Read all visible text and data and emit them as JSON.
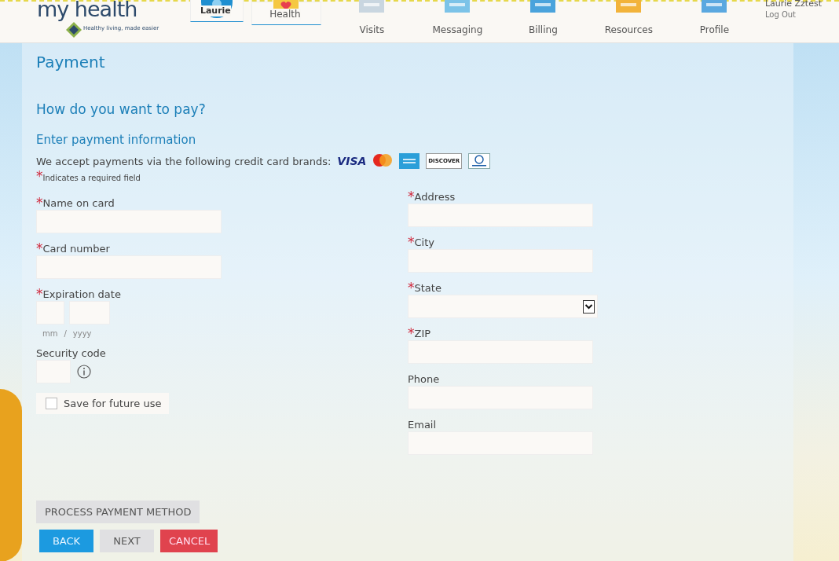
{
  "brand": {
    "name": "my health",
    "tagline": "Healthy living, made easier"
  },
  "nav": [
    {
      "label": "Laurie",
      "kind": "avatar",
      "selected": true
    },
    {
      "label": "Health",
      "kind": "heart",
      "selected": true
    },
    {
      "label": "Visits",
      "kind": "calendar",
      "selected": false
    },
    {
      "label": "Messaging",
      "kind": "mail",
      "selected": false
    },
    {
      "label": "Billing",
      "kind": "card",
      "selected": false
    },
    {
      "label": "Resources",
      "kind": "folder",
      "selected": false
    },
    {
      "label": "Profile",
      "kind": "id",
      "selected": false
    }
  ],
  "user": {
    "name": "Laurie Zztest",
    "logout": "Log Out"
  },
  "page_title": "Payment",
  "question": "How do you want to pay?",
  "section": "Enter payment information",
  "accept_text": "We accept payments via the following credit card brands:",
  "card_brands": [
    {
      "kind": "visa",
      "label": "VISA"
    },
    {
      "kind": "mastercard"
    },
    {
      "kind": "amex"
    },
    {
      "kind": "discover",
      "label": "DISCOVER"
    },
    {
      "kind": "diners"
    }
  ],
  "required_mark": "*",
  "required_note": "Indicates a required field",
  "left_fields": [
    {
      "kind": "text",
      "label": "Name on card",
      "required": true
    },
    {
      "kind": "text",
      "label": "Card number",
      "required": true
    },
    {
      "kind": "expiry",
      "label": "Expiration date",
      "required": true,
      "hints": [
        "mm",
        "/",
        "yyyy"
      ]
    },
    {
      "kind": "code",
      "label": "Security code",
      "required": false
    }
  ],
  "save_option": {
    "label": "Save for future use",
    "checked": false
  },
  "right_fields": [
    {
      "kind": "text",
      "label": "Address",
      "required": true
    },
    {
      "kind": "text",
      "label": "City",
      "required": true
    },
    {
      "kind": "select",
      "label": "State",
      "required": true
    },
    {
      "kind": "text",
      "label": "ZIP",
      "required": true
    },
    {
      "kind": "text",
      "label": "Phone",
      "required": false
    },
    {
      "kind": "text",
      "label": "Email",
      "required": false
    }
  ],
  "process_button": "PROCESS PAYMENT METHOD",
  "buttons": [
    {
      "label": "BACK",
      "kind": "primary"
    },
    {
      "label": "NEXT",
      "kind": "secondary"
    },
    {
      "label": "CANCEL",
      "kind": "danger"
    }
  ]
}
